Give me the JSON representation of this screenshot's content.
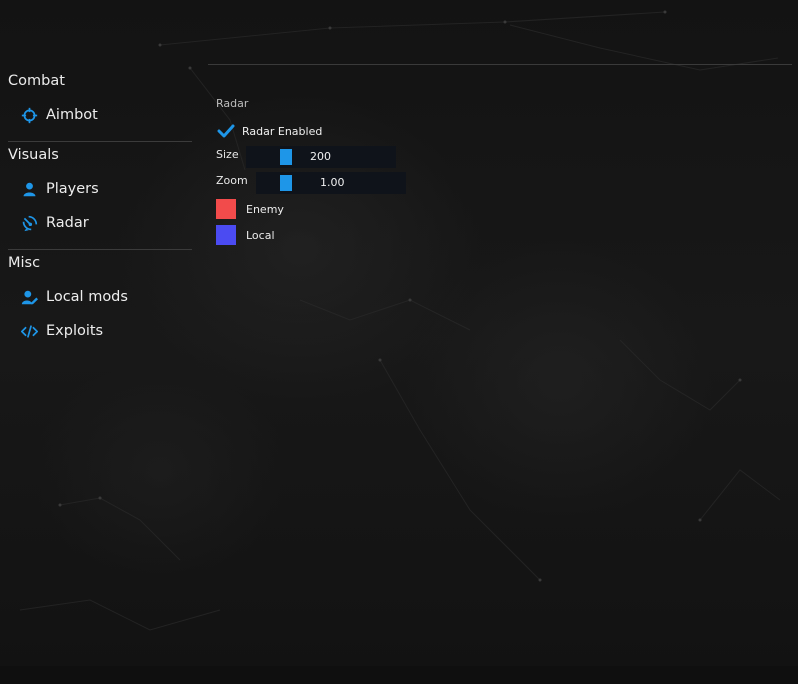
{
  "sidebar": {
    "sections": [
      {
        "title": "Combat",
        "items": [
          {
            "label": "Aimbot",
            "icon": "crosshair-icon"
          }
        ]
      },
      {
        "title": "Visuals",
        "items": [
          {
            "label": "Players",
            "icon": "user-icon"
          },
          {
            "label": "Radar",
            "icon": "radar-icon"
          }
        ]
      },
      {
        "title": "Misc",
        "items": [
          {
            "label": "Local mods",
            "icon": "user-edit-icon"
          },
          {
            "label": "Exploits",
            "icon": "code-icon"
          }
        ]
      }
    ]
  },
  "main": {
    "group_title": "Radar",
    "radar_enabled": {
      "label": "Radar Enabled",
      "checked": true
    },
    "sliders": {
      "size": {
        "label": "Size",
        "value": "200",
        "fraction": 0.0
      },
      "zoom": {
        "label": "Zoom",
        "value": "1.00",
        "fraction": 0.0
      }
    },
    "colors": {
      "enemy": {
        "label": "Enemy",
        "color": "#f24b4b"
      },
      "local": {
        "label": "Local",
        "color": "#4b4bf2"
      }
    }
  },
  "theme": {
    "accent": "#1e96e8",
    "background": "#141414",
    "track": "#0f131a"
  }
}
